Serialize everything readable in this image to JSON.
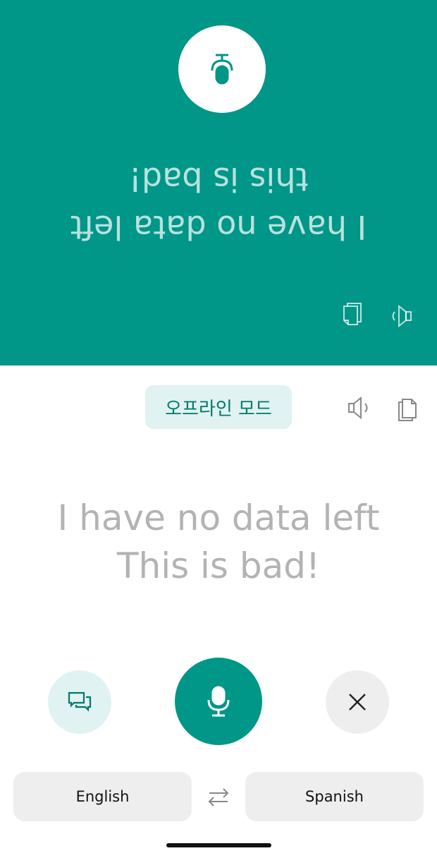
{
  "colors": {
    "accent": "#009688",
    "chip_bg": "#e0f2f1",
    "chip_text": "#00796b",
    "muted_text": "#b3b3b3"
  },
  "partner_panel": {
    "text_line1": "I have no data left",
    "text_line2": "this is bad!",
    "mic_icon": "mic-icon",
    "speaker_icon": "speaker-icon",
    "copy_icon": "copy-icon"
  },
  "user_panel": {
    "offline_label": "오프라인 모드",
    "text_line1": "I have no data left",
    "text_line2": "This is bad!",
    "speaker_icon": "speaker-icon",
    "copy_icon": "copy-icon"
  },
  "controls": {
    "conversation_icon": "conversation-icon",
    "mic_icon": "mic-icon",
    "close_icon": "close-icon",
    "swap_icon": "swap-icon"
  },
  "languages": {
    "source": "English",
    "target": "Spanish"
  }
}
